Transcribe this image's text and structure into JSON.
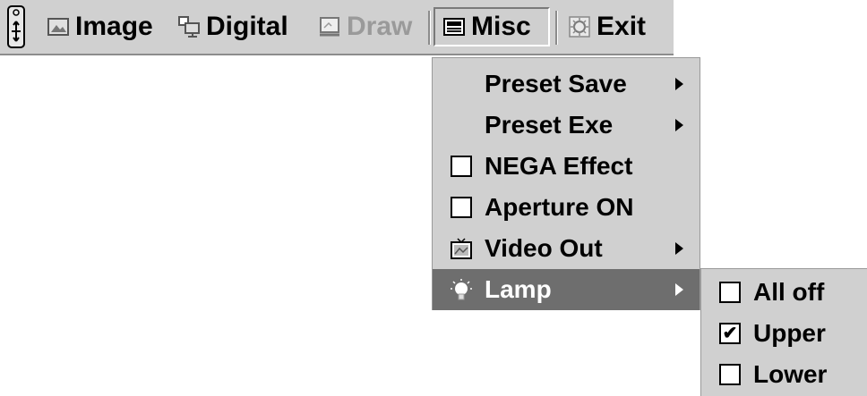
{
  "menubar": {
    "items": [
      {
        "label": "Image",
        "icon": "image-icon"
      },
      {
        "label": "Digital",
        "icon": "digital-icon"
      },
      {
        "label": "Draw",
        "icon": "draw-icon",
        "disabled": true
      },
      {
        "label": "Misc",
        "icon": "misc-icon",
        "active": true
      },
      {
        "label": "Exit",
        "icon": "exit-icon"
      }
    ]
  },
  "misc_menu": {
    "items": [
      {
        "label": "Preset Save",
        "submenu": true
      },
      {
        "label": "Preset Exe",
        "submenu": true
      },
      {
        "label": "NEGA Effect",
        "checkbox": true,
        "checked": false
      },
      {
        "label": "Aperture ON",
        "checkbox": true,
        "checked": false
      },
      {
        "label": "Video Out",
        "icon": "tv-icon",
        "submenu": true
      },
      {
        "label": "Lamp",
        "icon": "lamp-icon",
        "submenu": true,
        "highlighted": true
      }
    ]
  },
  "lamp_menu": {
    "items": [
      {
        "label": "All off",
        "checked": false
      },
      {
        "label": "Upper",
        "checked": true
      },
      {
        "label": "Lower",
        "checked": false
      }
    ]
  },
  "colors": {
    "bar": "#d0d0d0",
    "highlight": "#6e6e6e",
    "disabled_text": "#9a9a9a"
  }
}
